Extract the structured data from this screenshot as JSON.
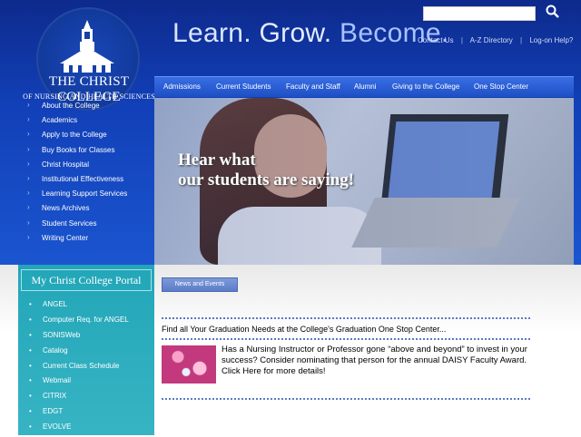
{
  "header": {
    "college_name": "THE CHRIST COLLEGE",
    "college_sub": "OF NURSING AND HEALTH SCIENCES",
    "tagline": {
      "w1": "Learn.",
      "w2": "Grow.",
      "w3": "Become."
    },
    "search": {
      "value": "",
      "placeholder": ""
    },
    "utility_links": [
      "Contact Us",
      "A-Z Directory",
      "Log-on Help?"
    ]
  },
  "topnav": [
    "Admissions",
    "Current Students",
    "Faculty and Staff",
    "Alumni",
    "Giving to the College",
    "One Stop Center"
  ],
  "leftnav": [
    "About the College",
    "Academics",
    "Apply to the College",
    "Buy Books for Classes",
    "Christ Hospital",
    "Institutional Effectiveness",
    "Learning Support Services",
    "News Archives",
    "Student Services",
    "Writing Center"
  ],
  "hero": {
    "line1": "Hear what",
    "line2": "our students are saying!"
  },
  "portal": {
    "title": "My Christ College Portal",
    "items": [
      "ANGEL",
      "Computer Req. for ANGEL",
      "SONISWeb",
      "Catalog",
      "Current Class Schedule",
      "Webmail",
      "CITRIX",
      "EDGT",
      "EVOLVE"
    ]
  },
  "news": {
    "tab_label": "News and Events",
    "graduation_link": "Find all Your Graduation Needs at the College's Graduation One Stop Center...",
    "daisy_text": "Has a Nursing Instructor or Professor gone “above and beyond” to invest in your success? Consider nominating that person for the annual DAISY Faculty Award. Click Here for more details!"
  }
}
